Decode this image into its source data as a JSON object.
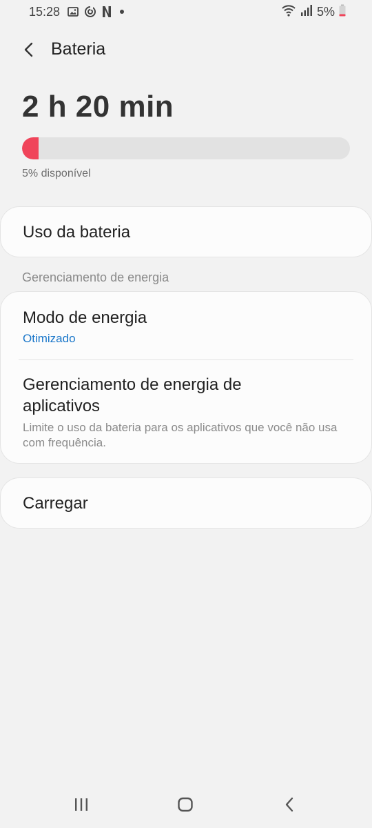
{
  "status_bar": {
    "time": "15:28",
    "battery_percent": "5%",
    "icons": [
      "gallery-icon",
      "sync-icon",
      "netflix-icon",
      "dot-icon",
      "wifi-icon",
      "signal-icon",
      "battery-icon"
    ]
  },
  "header": {
    "title": "Bateria",
    "back_icon": "chevron-left-icon"
  },
  "battery": {
    "remaining_time": "2 h 20 min",
    "level_fraction": 0.05,
    "available_text": "5% disponível",
    "fill_color": "#f0445a"
  },
  "usage": {
    "label": "Uso da bateria"
  },
  "section": {
    "label": "Gerenciamento de energia"
  },
  "energy_mode": {
    "label": "Modo de energia",
    "value": "Otimizado"
  },
  "app_power": {
    "label_line1": "Gerenciamento de energia de",
    "label_line2": "aplicativos",
    "description": "Limite o uso da bateria para os aplicativos que você não usa com frequência."
  },
  "charge": {
    "label": "Carregar"
  },
  "nav": {
    "icons": [
      "recents-icon",
      "home-icon",
      "back-icon"
    ]
  },
  "colors": {
    "accent": "#1976c9",
    "background": "#f2f2f2",
    "card": "#fcfcfc"
  }
}
